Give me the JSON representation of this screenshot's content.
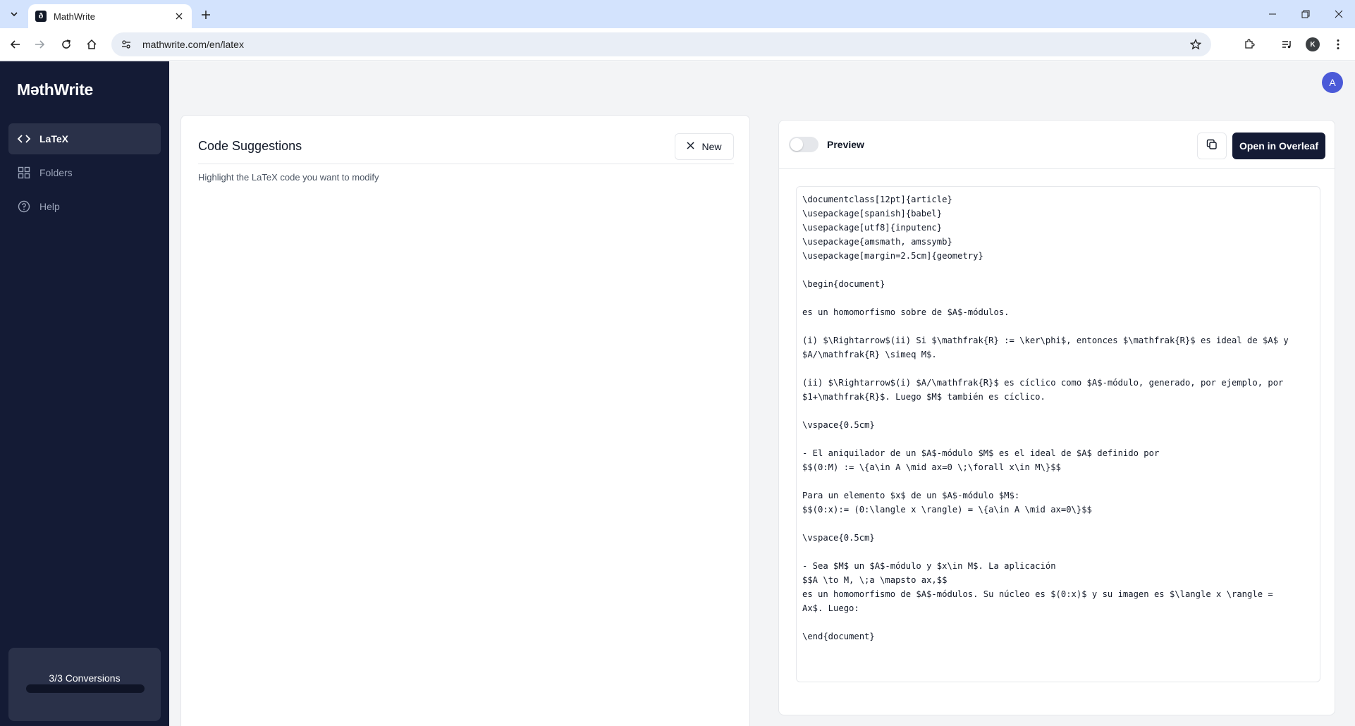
{
  "browser": {
    "tab_title": "MathWrite",
    "tab_favicon": "ð",
    "url": "mathwrite.com/en/latex",
    "profile_initial": "K"
  },
  "app": {
    "logo": "MəthWrite",
    "user_initial": "A"
  },
  "sidebar": {
    "items": [
      {
        "label": "LaTeX",
        "icon": "code-icon",
        "active": true
      },
      {
        "label": "Folders",
        "icon": "grid-icon",
        "active": false
      },
      {
        "label": "Help",
        "icon": "help-circle-icon",
        "active": false
      }
    ],
    "conversions": {
      "label": "3/3 Conversions",
      "used": 3,
      "total": 3
    }
  },
  "suggestions": {
    "title": "Code Suggestions",
    "new_label": "New",
    "hint": "Highlight the LaTeX code you want to modify"
  },
  "editor": {
    "preview_label": "Preview",
    "preview_on": false,
    "overleaf_label": "Open in Overleaf",
    "code_lines": [
      "\\documentclass[12pt]{article}",
      "\\usepackage[spanish]{babel}",
      "\\usepackage[utf8]{inputenc}",
      "\\usepackage{amsmath, amssymb}",
      "\\usepackage[margin=2.5cm]{geometry}",
      "",
      "\\begin{document}",
      "",
      "es un homomorfismo sobre de $A$-módulos.",
      "",
      "(i) $\\Rightarrow$(ii) Si $\\mathfrak{R} := \\ker\\phi$, entonces $\\mathfrak{R}$ es ideal de $A$ y",
      "$A/\\mathfrak{R} \\simeq M$.",
      "",
      "(ii) $\\Rightarrow$(i) $A/\\mathfrak{R}$ es cíclico como $A$-módulo, generado, por ejemplo, por",
      "$1+\\mathfrak{R}$. Luego $M$ también es cíclico.",
      "",
      "\\vspace{0.5cm}",
      "",
      "- El aniquilador de un $A$-módulo $M$ es el ideal de $A$ definido por",
      "$$(0:M) := \\{a\\in A \\mid ax=0 \\;\\forall x\\in M\\}$$",
      "",
      "Para un elemento $x$ de un $A$-módulo $M$:",
      "$$(0:x):= (0:\\langle x \\rangle) = \\{a\\in A \\mid ax=0\\}$$",
      "",
      "\\vspace{0.5cm}",
      "",
      "- Sea $M$ un $A$-módulo y $x\\in M$. La aplicación",
      "$$A \\to M, \\;a \\mapsto ax,$$",
      "es un homomorfismo de $A$-módulos. Su núcleo es $(0:x)$ y su imagen es $\\langle x \\rangle =",
      "Ax$. Luego:",
      "",
      "\\end{document}"
    ]
  }
}
